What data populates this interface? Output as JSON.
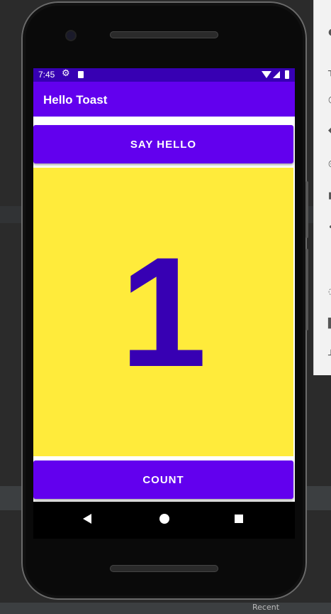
{
  "ide": {
    "bottom_label": "Recent"
  },
  "status_bar": {
    "time": "7:45",
    "icons": [
      "gear-icon",
      "sd-card-icon",
      "wifi-icon",
      "signal-icon",
      "battery-icon"
    ]
  },
  "app_bar": {
    "title": "Hello Toast"
  },
  "main": {
    "say_hello_label": "SAY HELLO",
    "count_value": "1",
    "count_label": "COUNT"
  },
  "nav_bar": {
    "icons": [
      "back-icon",
      "home-icon",
      "recents-icon"
    ]
  },
  "colors": {
    "status_bar": "#3700b3",
    "primary": "#6200ee",
    "count_background": "#ffeb3b",
    "count_text": "#3700b3"
  }
}
